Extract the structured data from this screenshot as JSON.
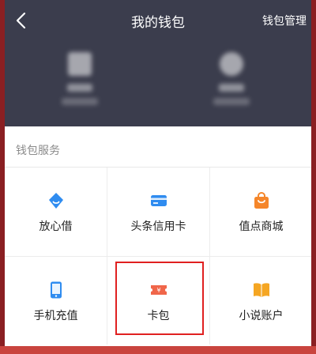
{
  "header": {
    "title": "我的钱包",
    "manage_label": "钱包管理"
  },
  "assets": [
    {
      "icon": "envelope-icon"
    },
    {
      "icon": "coin-icon"
    }
  ],
  "services": {
    "section_title": "钱包服务",
    "items": [
      {
        "label": "放心借",
        "icon": "loan-icon",
        "color": "#2f8cf0"
      },
      {
        "label": "头条信用卡",
        "icon": "credit-card-icon",
        "color": "#2f8cf0"
      },
      {
        "label": "值点商城",
        "icon": "shopping-bag-icon",
        "color": "#f5862a"
      },
      {
        "label": "手机充值",
        "icon": "phone-icon",
        "color": "#2f8cf0"
      },
      {
        "label": "卡包",
        "icon": "coupon-icon",
        "color": "#f0664a"
      },
      {
        "label": "小说账户",
        "icon": "book-icon",
        "color": "#f5a623"
      }
    ]
  }
}
